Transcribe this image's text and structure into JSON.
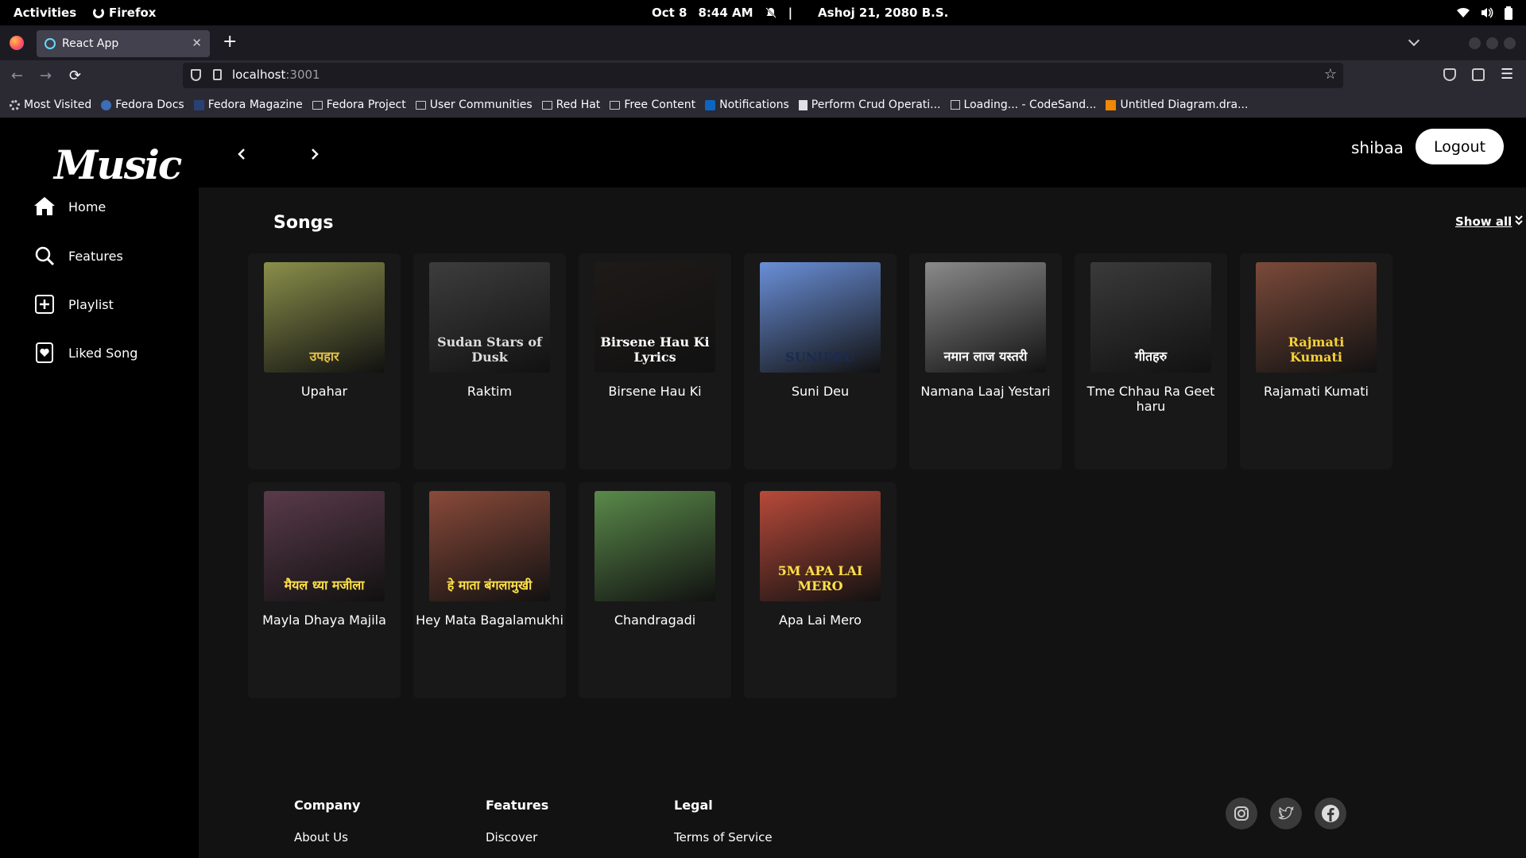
{
  "system_bar": {
    "activities": "Activities",
    "app_name": "Firefox",
    "date": "Oct 8",
    "time": "8:44 AM",
    "separator": "|",
    "nepali_date": "Ashoj 21, 2080 B.S."
  },
  "browser": {
    "tab_title": "React App",
    "url_host": "localhost",
    "url_port": ":3001",
    "bookmarks": [
      {
        "label": "Most Visited",
        "icon": "gear-icon"
      },
      {
        "label": "Fedora Docs",
        "icon": "fedora-icon"
      },
      {
        "label": "Fedora Magazine",
        "icon": "fm-icon"
      },
      {
        "label": "Fedora Project",
        "icon": "folder-icon"
      },
      {
        "label": "User Communities",
        "icon": "folder-icon"
      },
      {
        "label": "Red Hat",
        "icon": "folder-icon"
      },
      {
        "label": "Free Content",
        "icon": "folder-icon"
      },
      {
        "label": "Notifications",
        "icon": "linkedin-icon"
      },
      {
        "label": "Perform Crud Operati...",
        "icon": "page-icon"
      },
      {
        "label": "Loading... - CodeSand...",
        "icon": "box-icon"
      },
      {
        "label": "Untitled Diagram.dra...",
        "icon": "drawio-icon"
      }
    ]
  },
  "app": {
    "logo_text": "Music",
    "username": "shibaa",
    "logout_label": "Logout",
    "sidebar": [
      {
        "label": "Home",
        "icon": "home-icon"
      },
      {
        "label": "Features",
        "icon": "search-icon"
      },
      {
        "label": "Playlist",
        "icon": "plus-square-icon"
      },
      {
        "label": "Liked Song",
        "icon": "heart-square-icon"
      }
    ],
    "section_title": "Songs",
    "show_all_label": "Show all",
    "songs": [
      {
        "title": "Upahar",
        "thumb_text": "उपहार",
        "bg": "#8a8f4a",
        "fg": "#e8c24a"
      },
      {
        "title": "Raktim",
        "thumb_text": "Sudan Stars of Dusk",
        "bg": "#3d3d3d",
        "fg": "#dddddd"
      },
      {
        "title": "Birsene Hau Ki",
        "thumb_text": "Birsene Hau Ki Lyrics",
        "bg": "#1e1a18",
        "fg": "#ffffff"
      },
      {
        "title": "Suni Deu",
        "thumb_text": "SUNIDEU",
        "bg": "#6a8fd8",
        "fg": "#1a2a50"
      },
      {
        "title": "Namana Laaj Yestari",
        "thumb_text": "नमान लाज यस्तरी",
        "bg": "#8a8a8a",
        "fg": "#ffffff"
      },
      {
        "title": "Tme Chhau Ra Geet haru",
        "thumb_text": "गीतहरु",
        "bg": "#3a3a3a",
        "fg": "#ffffff"
      },
      {
        "title": "Rajamati Kumati",
        "thumb_text": "Rajmati Kumati",
        "bg": "#7a4a3a",
        "fg": "#f5d13a"
      },
      {
        "title": "Mayla Dhaya Majila",
        "thumb_text": "मैयल ध्या मजीला",
        "bg": "#5a3a4a",
        "fg": "#ffe14a"
      },
      {
        "title": "Hey Mata Bagalamukhi",
        "thumb_text": "हे माता बंगलामुखी",
        "bg": "#8a4a3a",
        "fg": "#ffe14a"
      },
      {
        "title": "Chandragadi",
        "thumb_text": "",
        "bg": "#5a8a4a",
        "fg": "#ffffff"
      },
      {
        "title": "Apa Lai Mero",
        "thumb_text": "5M APA LAI MERO",
        "bg": "#b84a3a",
        "fg": "#ffe14a"
      }
    ],
    "footer": {
      "columns": [
        {
          "heading": "Company",
          "link": "About Us"
        },
        {
          "heading": "Features",
          "link": "Discover"
        },
        {
          "heading": "Legal",
          "link": "Terms of Service"
        }
      ],
      "social": [
        {
          "icon": "instagram-icon"
        },
        {
          "icon": "twitter-icon"
        },
        {
          "icon": "facebook-icon"
        }
      ]
    }
  }
}
